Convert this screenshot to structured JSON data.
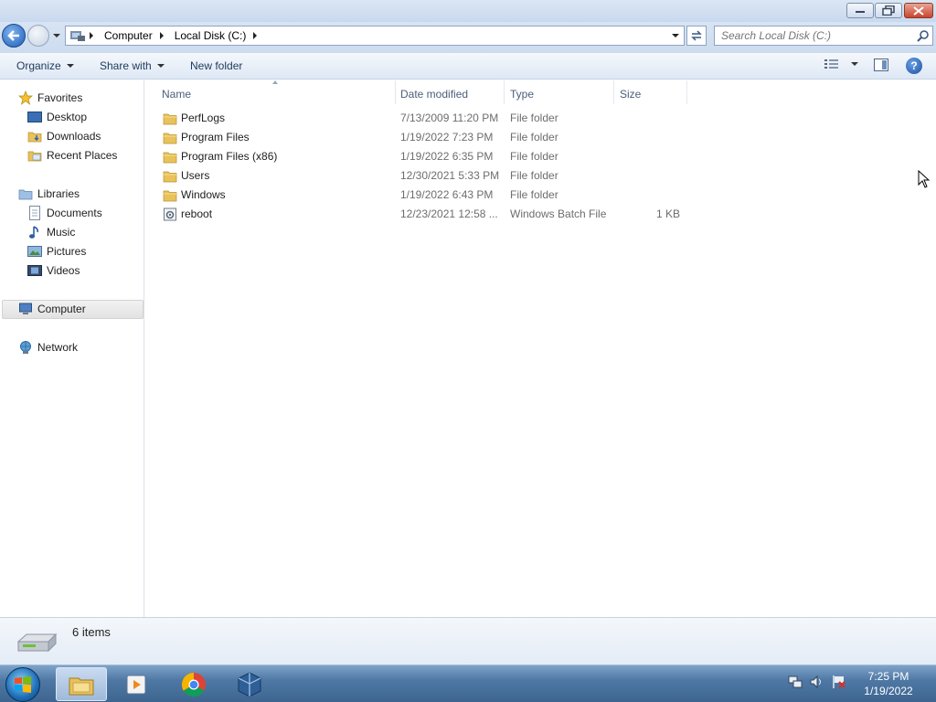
{
  "window": {
    "minimize_glyph": "—",
    "restore_glyph": "❐",
    "close_glyph": "✕"
  },
  "address": {
    "crumbs": [
      "Computer",
      "Local Disk (C:)"
    ],
    "search_placeholder": "Search Local Disk (C:)"
  },
  "toolbar": {
    "organize": "Organize",
    "share_with": "Share with",
    "new_folder": "New folder",
    "help": "?"
  },
  "nav": {
    "favorites": "Favorites",
    "desktop": "Desktop",
    "downloads": "Downloads",
    "recent_places": "Recent Places",
    "libraries": "Libraries",
    "documents": "Documents",
    "music": "Music",
    "pictures": "Pictures",
    "videos": "Videos",
    "computer": "Computer",
    "network": "Network"
  },
  "columns": {
    "name": "Name",
    "date_modified": "Date modified",
    "type": "Type",
    "size": "Size"
  },
  "files": [
    {
      "name": "PerfLogs",
      "date": "7/13/2009 11:20 PM",
      "type": "File folder",
      "size": "",
      "icon": "folder-icon"
    },
    {
      "name": "Program Files",
      "date": "1/19/2022 7:23 PM",
      "type": "File folder",
      "size": "",
      "icon": "folder-icon"
    },
    {
      "name": "Program Files (x86)",
      "date": "1/19/2022 6:35 PM",
      "type": "File folder",
      "size": "",
      "icon": "folder-icon"
    },
    {
      "name": "Users",
      "date": "12/30/2021 5:33 PM",
      "type": "File folder",
      "size": "",
      "icon": "folder-icon"
    },
    {
      "name": "Windows",
      "date": "1/19/2022 6:43 PM",
      "type": "File folder",
      "size": "",
      "icon": "folder-icon"
    },
    {
      "name": "reboot",
      "date": "12/23/2021 12:58 ...",
      "type": "Windows Batch File",
      "size": "1 KB",
      "icon": "batch-file-icon"
    }
  ],
  "status": {
    "items_count": "6 items"
  },
  "taskbar": {
    "time": "7:25 PM",
    "date": "1/19/2022"
  },
  "colors": {
    "titlebar": "#dbe6f4",
    "accent_text": "#1e395b",
    "folder": "#e8c25a",
    "taskbar": "#4f78a5"
  }
}
